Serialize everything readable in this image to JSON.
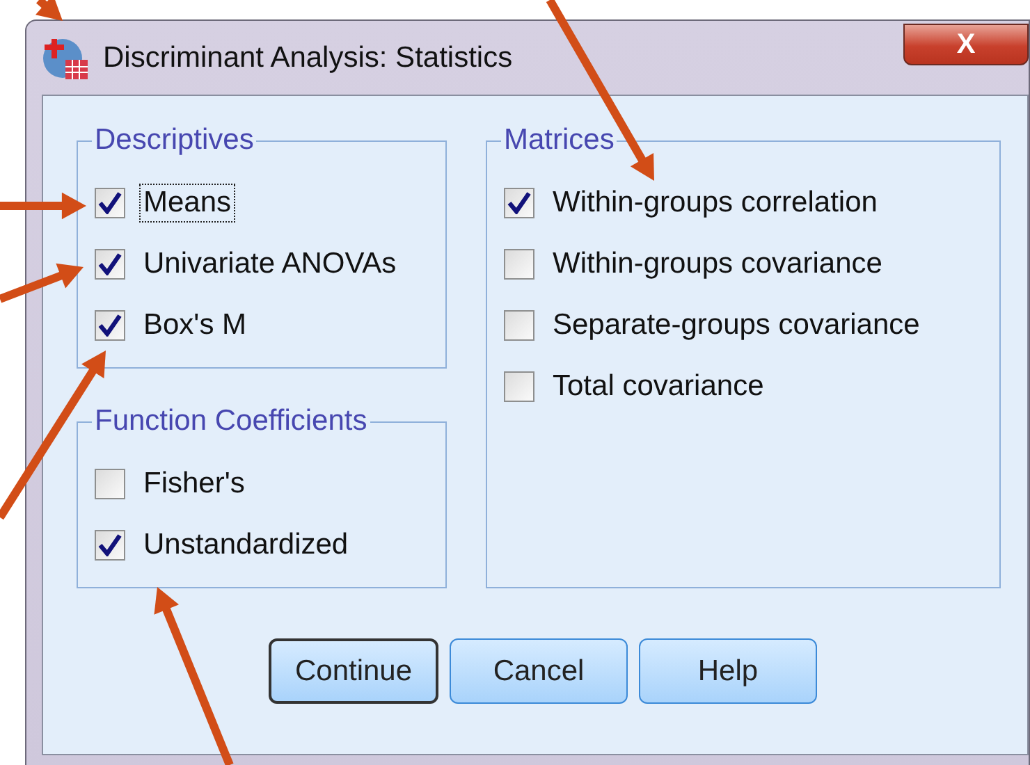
{
  "window": {
    "title": "Discriminant Analysis: Statistics",
    "close": "X"
  },
  "left_column": [
    {
      "title": "Descriptives",
      "items": [
        {
          "label": "Means",
          "checked": true,
          "focused": true
        },
        {
          "label": "Univariate ANOVAs",
          "checked": true,
          "focused": false
        },
        {
          "label": "Box's M",
          "checked": true,
          "focused": false
        }
      ]
    },
    {
      "title": "Function Coefficients",
      "items": [
        {
          "label": "Fisher's",
          "checked": false,
          "focused": false
        },
        {
          "label": "Unstandardized",
          "checked": true,
          "focused": false
        }
      ]
    }
  ],
  "right_column": [
    {
      "title": "Matrices",
      "items": [
        {
          "label": "Within-groups correlation",
          "checked": true,
          "focused": false
        },
        {
          "label": "Within-groups covariance",
          "checked": false,
          "focused": false
        },
        {
          "label": "Separate-groups covariance",
          "checked": false,
          "focused": false
        },
        {
          "label": "Total covariance",
          "checked": false,
          "focused": false
        }
      ]
    }
  ],
  "buttons": [
    {
      "label": "Continue",
      "default": true
    },
    {
      "label": "Cancel",
      "default": false
    },
    {
      "label": "Help",
      "default": false
    }
  ]
}
